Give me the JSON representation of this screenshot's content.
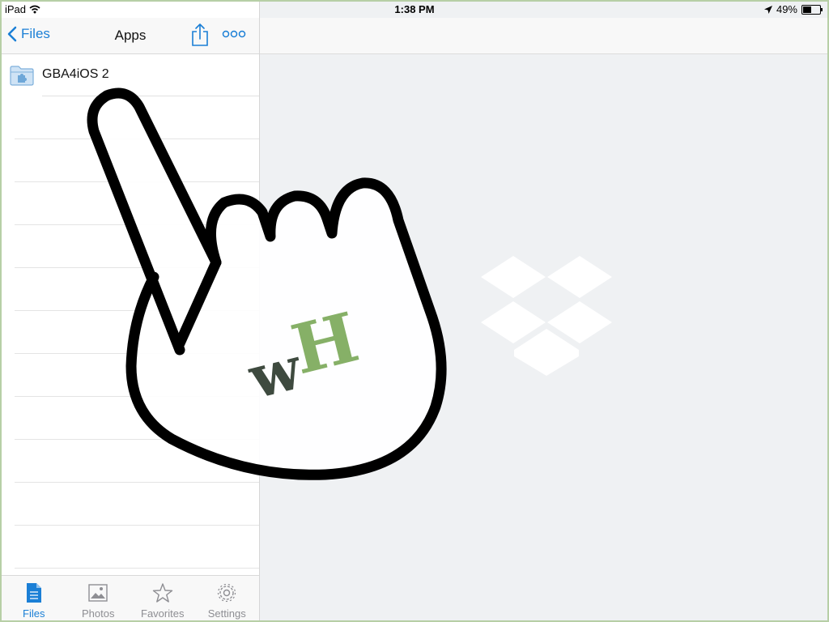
{
  "status": {
    "device": "iPad",
    "time": "1:38 PM",
    "battery": "49%",
    "battery_level": 0.49
  },
  "sidebar": {
    "back_label": "Files",
    "title": "Apps",
    "share_icon": "share-icon",
    "more_icon": "more-icon",
    "files": [
      {
        "name": "GBA4iOS 2",
        "icon": "app-folder-icon"
      }
    ]
  },
  "tabbar": {
    "tabs": [
      {
        "label": "Files",
        "icon": "file-icon",
        "active": true
      },
      {
        "label": "Photos",
        "icon": "photo-icon",
        "active": false
      },
      {
        "label": "Favorites",
        "icon": "star-icon",
        "active": false
      },
      {
        "label": "Settings",
        "icon": "gear-icon",
        "active": false
      }
    ]
  },
  "watermark": {
    "text_w": "w",
    "text_h": "H"
  },
  "colors": {
    "accent": "#1b7fd6",
    "frame": "#b7cfa6",
    "watermark_dark": "#3e4a3f",
    "watermark_green": "#86b067"
  }
}
